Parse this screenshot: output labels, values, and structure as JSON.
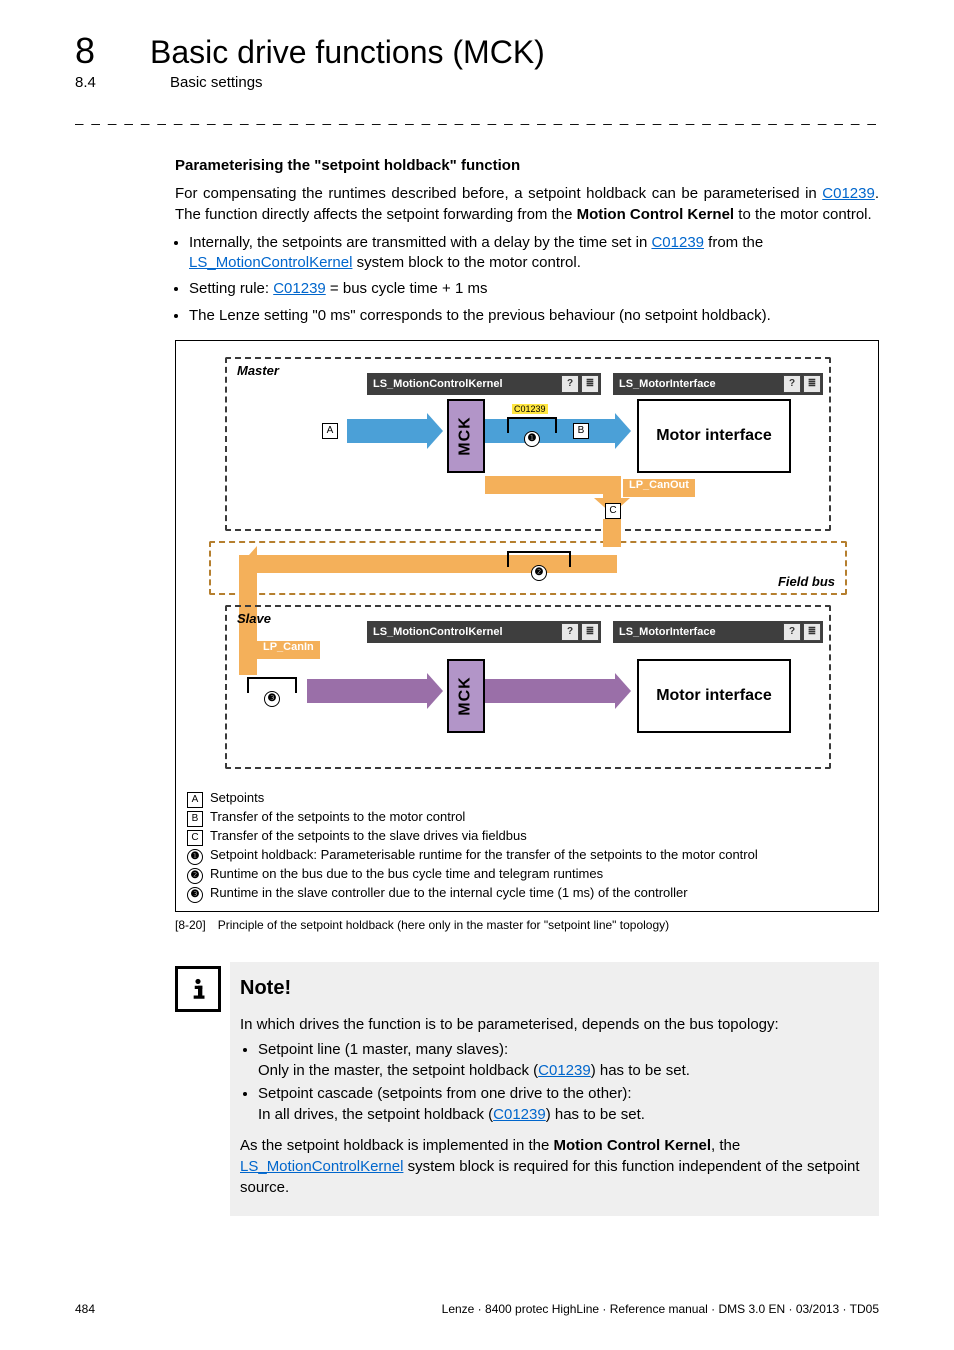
{
  "chapter": {
    "num": "8",
    "title": "Basic drive functions (MCK)"
  },
  "section": {
    "num": "8.4",
    "title": "Basic settings"
  },
  "dashes": "_ _ _ _ _ _ _ _ _ _ _ _ _ _ _ _ _ _ _ _ _ _ _ _ _ _ _ _ _ _ _ _ _ _ _ _ _ _ _ _ _ _ _ _ _ _ _ _ _ _ _ _ _ _ _ _ _ _ _ _ _ _ _ _",
  "heading": "Parameterising the \"setpoint holdback\" function",
  "paragraph": {
    "p1a": "For compensating the runtimes described before, a setpoint holdback can be parameterised in ",
    "p1_link1": "C01239",
    "p1b": ". The function directly affects the setpoint forwarding from the ",
    "p1_bold": "Motion Control Kernel",
    "p1c": " to the motor control."
  },
  "bullets": {
    "b1a": "Internally, the setpoints are transmitted with a delay by the time set in ",
    "b1_link1": "C01239",
    "b1b": " from the ",
    "b1_link2": "LS_MotionControlKernel",
    "b1c": " system block to the motor control.",
    "b2a": "Setting rule: ",
    "b2_link": "C01239",
    "b2b": " = bus cycle time + 1 ms",
    "b3": "The Lenze setting \"0 ms\" corresponds to the previous behaviour (no setpoint holdback)."
  },
  "diagram": {
    "master": "Master",
    "slave": "Slave",
    "fieldbus": "Field bus",
    "mck": "MCK",
    "motor_if": "Motor interface",
    "ls_mck": "LS_MotionControlKernel",
    "ls_mi": "LS_MotorInterface",
    "lp_canout": "LP_CanOut",
    "lp_canin": "LP_CanIn",
    "c_tag": "C01239",
    "A": "A",
    "B": "B",
    "C": "C",
    "n1": "❶",
    "n2": "❷",
    "n3": "❸",
    "q": "?",
    "list": "≣"
  },
  "legend": {
    "A": "Setpoints",
    "B": "Transfer of the setpoints to the motor control",
    "C": "Transfer of the setpoints to the slave drives via fieldbus",
    "n1": "Setpoint holdback: Parameterisable runtime for the transfer of the setpoints to the motor control",
    "n2": "Runtime on the bus due to the bus cycle time and telegram runtimes",
    "n3": "Runtime in the slave controller due to the internal cycle time (1 ms) of the controller"
  },
  "caption": {
    "num": "[8-20]",
    "text": "Principle of the setpoint holdback (here only in the master for \"setpoint line\" topology)"
  },
  "note": {
    "title": "Note!",
    "intro": "In which drives the function is to be parameterised, depends on the bus topology:",
    "li1a": "Setpoint line (1 master, many slaves):",
    "li1b_a": "Only in the master, the setpoint holdback (",
    "li1b_link": "C01239",
    "li1b_b": ") has to be set.",
    "li2a": "Setpoint cascade (setpoints from one drive to the other):",
    "li2b_a": "In all drives, the setpoint holdback (",
    "li2b_link": "C01239",
    "li2b_b": ") has to be set.",
    "out_a": "As the setpoint holdback is implemented in the ",
    "out_bold": "Motion Control Kernel",
    "out_b": ", the ",
    "out_link": "LS_MotionControlKernel",
    "out_c": " system block is required for this function independent of the setpoint source."
  },
  "footer": {
    "page": "484",
    "meta": "Lenze · 8400 protec HighLine · Reference manual · DMS 3.0 EN · 03/2013 · TD05"
  }
}
